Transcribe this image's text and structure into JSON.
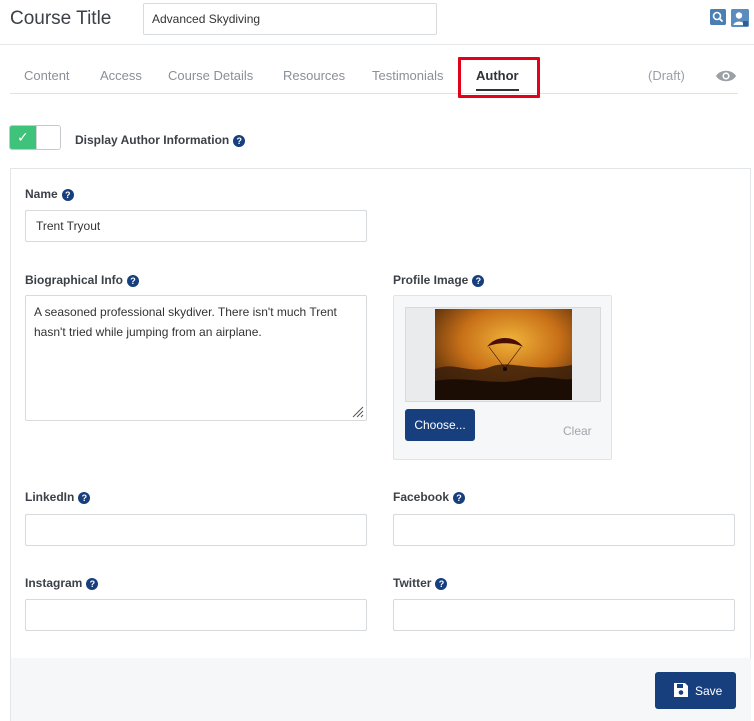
{
  "header": {
    "title_label": "Course Title",
    "title_value": "Advanced Skydiving"
  },
  "tabs": [
    {
      "label": "Content"
    },
    {
      "label": "Access"
    },
    {
      "label": "Course Details"
    },
    {
      "label": "Resources"
    },
    {
      "label": "Testimonials"
    },
    {
      "label": "Author"
    }
  ],
  "active_tab": "Author",
  "status": "(Draft)",
  "toggle": {
    "label": "Display Author Information",
    "checked": true
  },
  "fields": {
    "name": {
      "label": "Name",
      "value": "Trent Tryout"
    },
    "bio": {
      "label": "Biographical Info",
      "value": "A seasoned professional skydiver. There isn't much Trent hasn't tried while jumping from an airplane."
    },
    "profile_image": {
      "label": "Profile Image",
      "choose_label": "Choose...",
      "clear_label": "Clear"
    },
    "linkedin": {
      "label": "LinkedIn",
      "value": ""
    },
    "facebook": {
      "label": "Facebook",
      "value": ""
    },
    "instagram": {
      "label": "Instagram",
      "value": ""
    },
    "twitter": {
      "label": "Twitter",
      "value": ""
    }
  },
  "save_label": "Save",
  "colors": {
    "primary": "#173e7d",
    "toggle_on": "#3fc27a",
    "highlight": "#e3001b"
  }
}
